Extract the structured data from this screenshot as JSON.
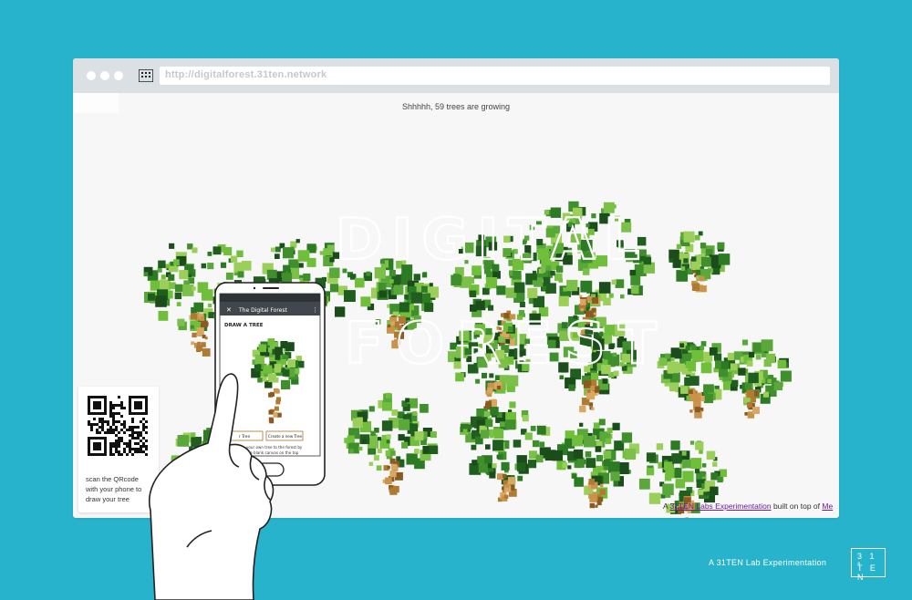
{
  "colors": {
    "background": "#27b3cb",
    "window": "#f7f7f7",
    "chrome": "#dbe0e4",
    "tree_dark": "#1f5e1f",
    "tree_light": "#6fbf3a",
    "trunk": "#b07a32"
  },
  "browser": {
    "url": "http://digitalforest.31ten.network"
  },
  "page": {
    "status": "Shhhhh, 59 trees are growing",
    "title_line1": "DIGITAL",
    "title_line2": "FOREST",
    "credit_prefix": "A ",
    "credit_link": "31TEN Labs Experimentation",
    "credit_suffix": " built on top of ",
    "credit_link2": "Me"
  },
  "qr_card": {
    "text_line1": "scan the QRcode",
    "text_line2": "with your phone to",
    "text_line3": "draw your tree"
  },
  "phone": {
    "app_title": "The Digital Forest",
    "heading": "DRAW A TREE",
    "btn_left": "r Tree",
    "btn_right": "Create a new Tree",
    "caption_line1": "your own tree to the forest by",
    "caption_line2": "the blank canvas on the top"
  },
  "branding": {
    "tagline": "A 31TEN Lab Experimentation",
    "logo_top": "3 1 °",
    "logo_bottom": "T E N"
  },
  "icons": [
    "window-dot-icon",
    "grid-icon",
    "close-icon",
    "menu-dots-icon",
    "qr-code-icon",
    "hand-icon",
    "brand-logo-icon"
  ]
}
